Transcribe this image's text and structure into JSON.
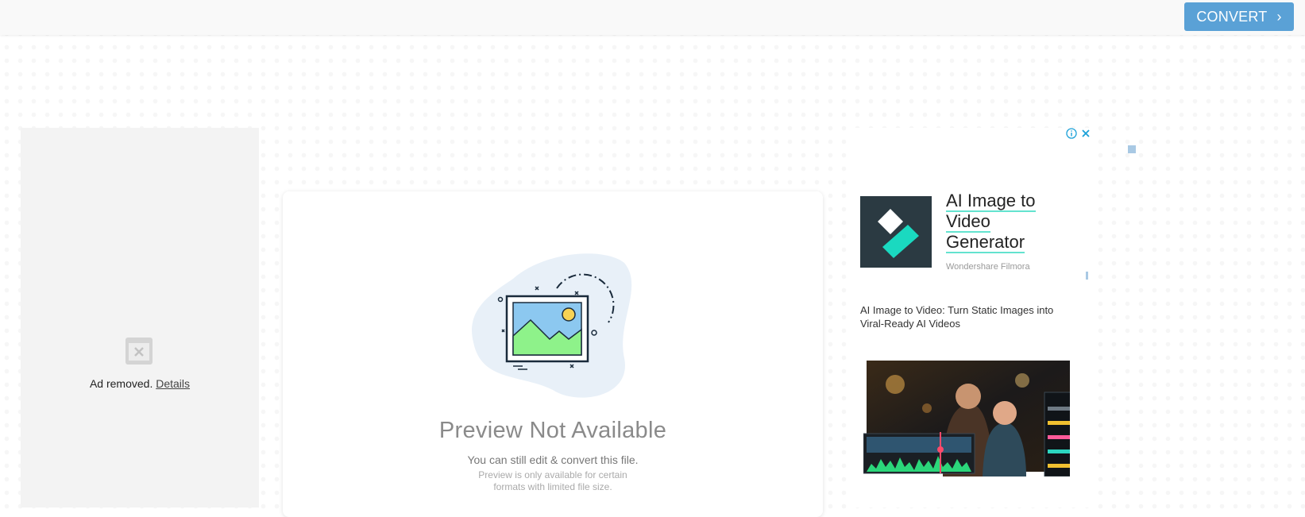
{
  "topbar": {
    "convert_label": "CONVERT",
    "convert_icon": "chevron-right-icon",
    "accent": "#5aa1d6"
  },
  "left_ad": {
    "removed_text": "Ad removed.",
    "details_link": "Details",
    "icon": "ad-removed-icon"
  },
  "preview": {
    "title": "Preview Not Available",
    "subtitle": "You can still edit & convert this file.",
    "note": "Preview is only available for certain formats with limited file size.",
    "icon": "image-placeholder-icon"
  },
  "right_ad": {
    "headline_line1": "AI Image to",
    "headline_line2": "Video",
    "headline_line3": "Generator",
    "brand": "Wondershare Filmora",
    "description": "AI Image to Video: Turn Static Images into Viral-Ready AI Videos",
    "info_icon": "info-icon",
    "close_icon": "close-icon",
    "accent": "#1ad9c0"
  }
}
